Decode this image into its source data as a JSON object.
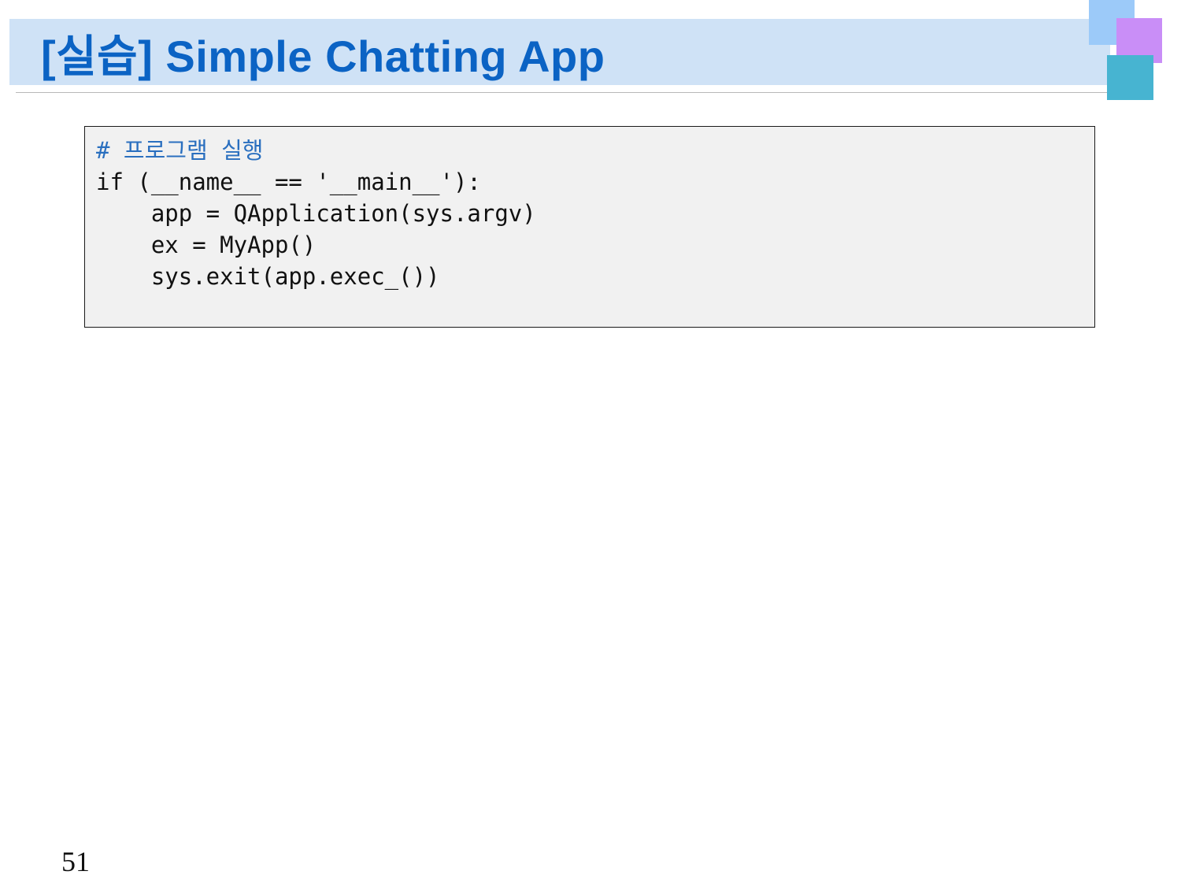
{
  "slide": {
    "title": "[실습] Simple Chatting App",
    "page_number": "51"
  },
  "code": {
    "lines": [
      "# 프로그램 실행",
      "if (__name__ == '__main__'):",
      "    app = QApplication(sys.argv)",
      "    ex = MyApp()",
      "    sys.exit(app.exec_())"
    ]
  },
  "colors": {
    "title_text": "#0b63c4",
    "title_band": "#cfe2f6",
    "deco_blue": "#9ccaf9",
    "deco_purple": "#c98ef7",
    "deco_teal": "#47b4d1",
    "code_background": "#f1f1f1",
    "comment_text": "#2a6fbf"
  }
}
